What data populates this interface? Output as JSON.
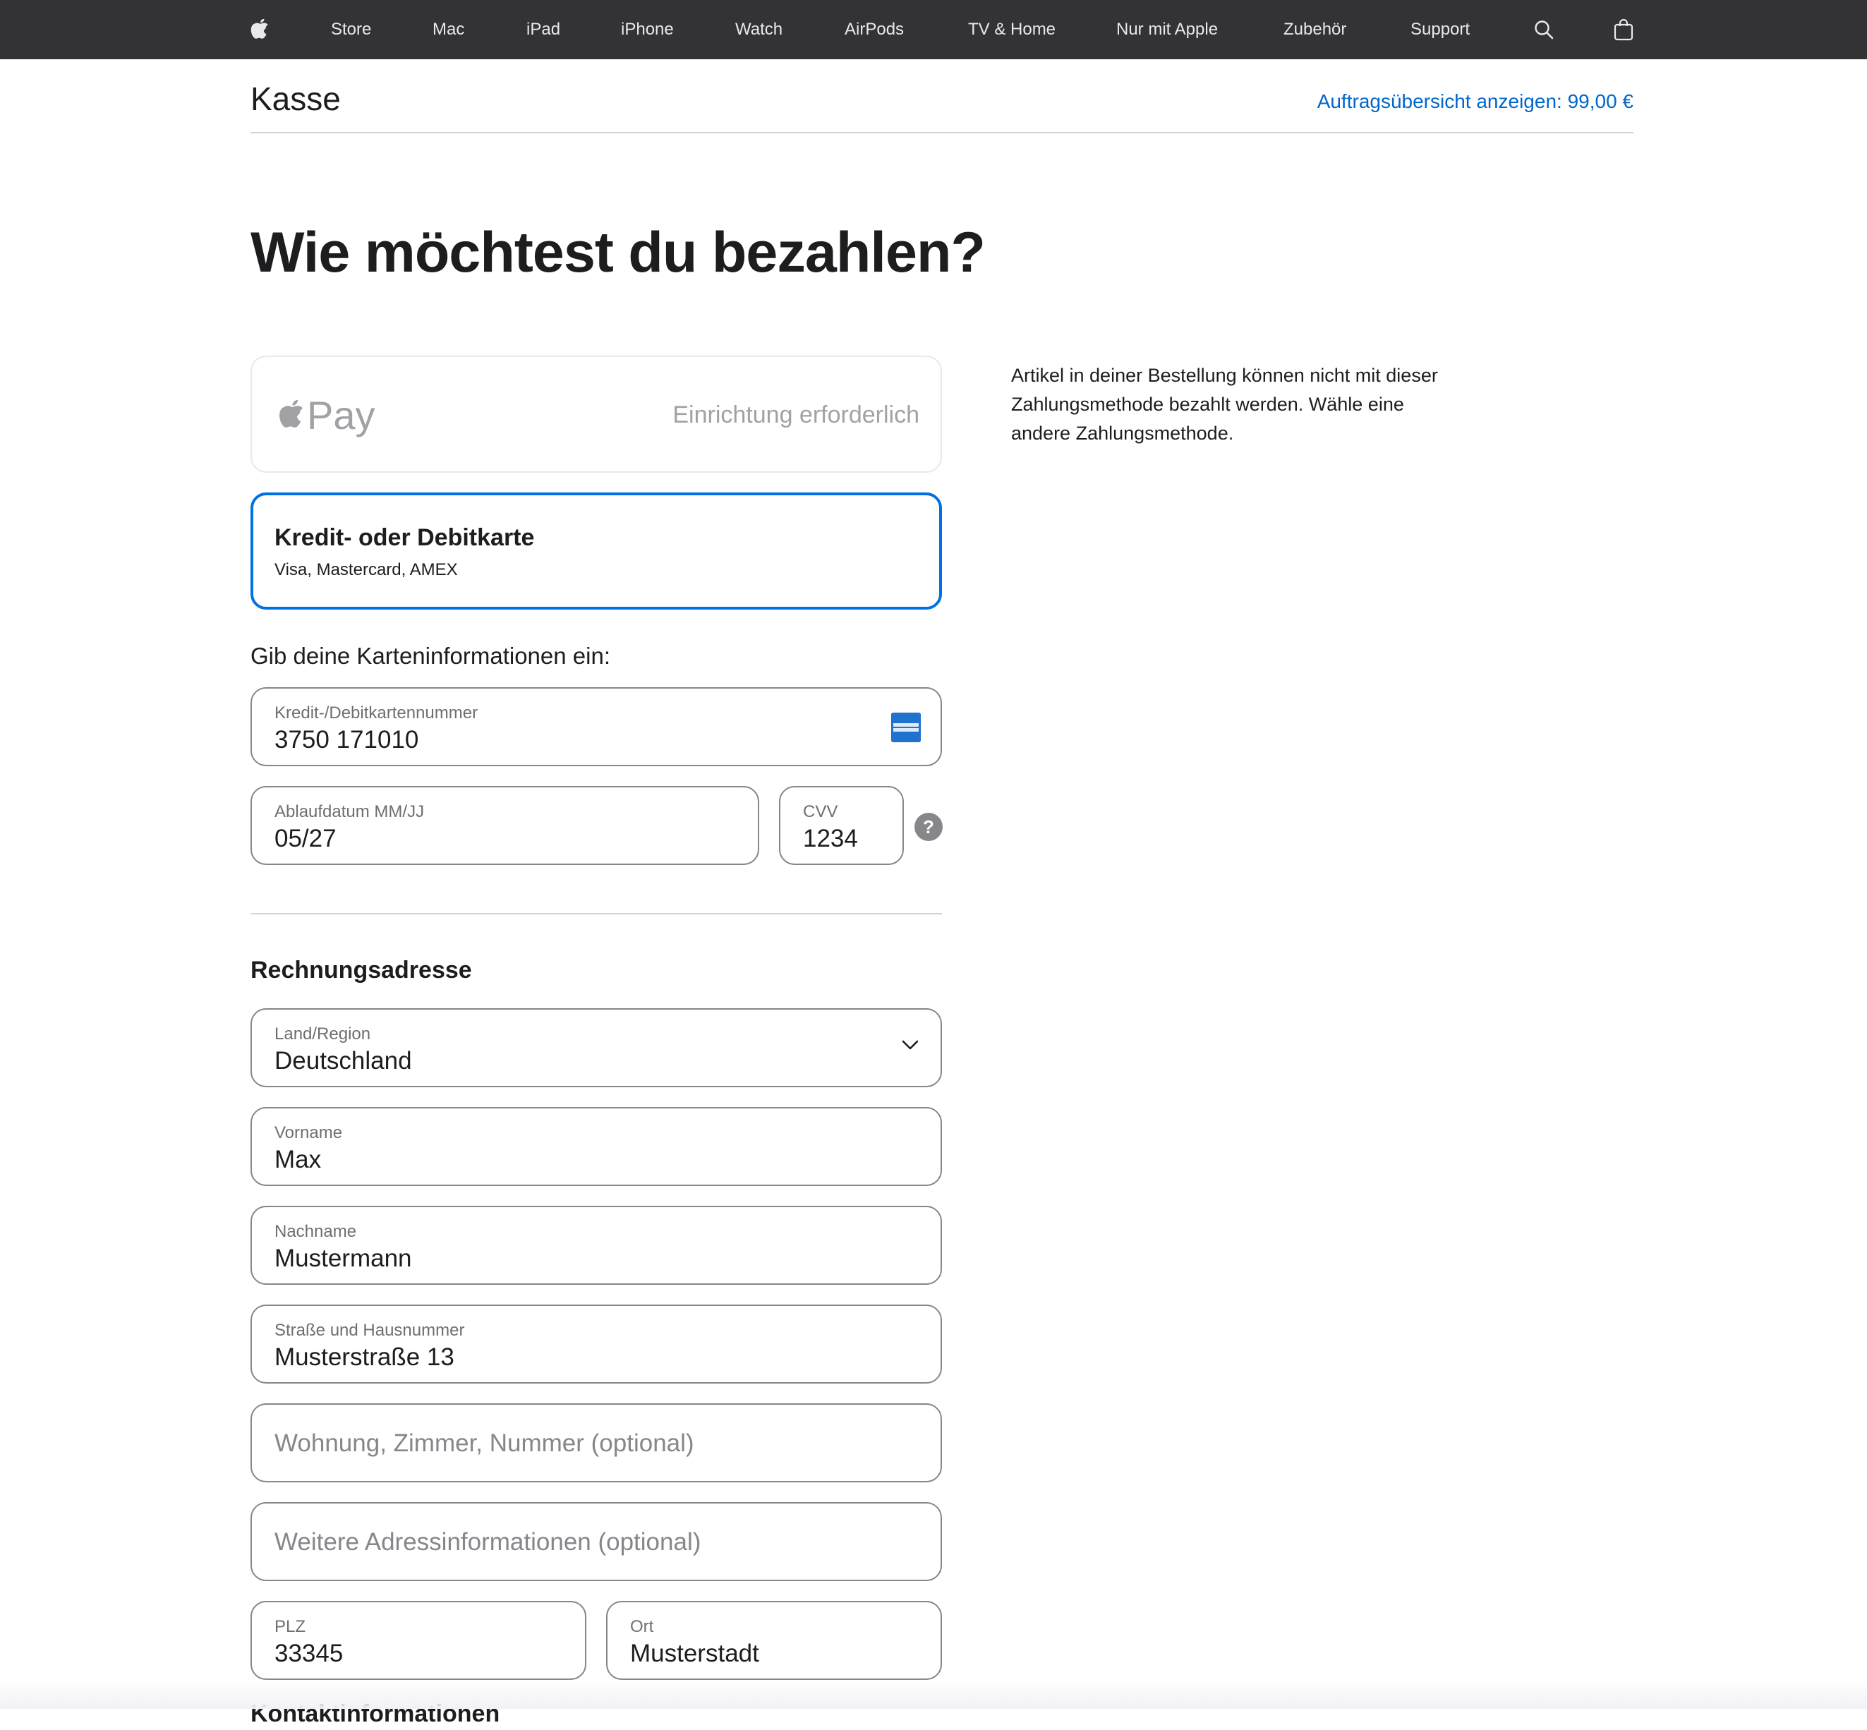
{
  "nav": {
    "items": [
      "Store",
      "Mac",
      "iPad",
      "iPhone",
      "Watch",
      "AirPods",
      "TV & Home",
      "Nur mit Apple",
      "Zubehör",
      "Support"
    ],
    "icons": {
      "logo": "apple-logo-icon",
      "search": "search-icon",
      "bag": "shopping-bag-icon"
    }
  },
  "header": {
    "title": "Kasse",
    "order_summary_link": "Auftragsübersicht anzeigen: 99,00 €"
  },
  "heading": "Wie möchtest du bezahlen?",
  "payment_options": {
    "apple_pay": {
      "logo_text": "Pay",
      "status": "Einrichtung erforderlich"
    },
    "card": {
      "title": "Kredit- oder Debitkarte",
      "subtitle": "Visa, Mastercard, AMEX"
    }
  },
  "side_note": "Artikel in deiner Bestellung können nicht mit dieser Zahlungsmethode bezahlt werden. Wähle eine andere Zahlungsmethode.",
  "card_form": {
    "prompt": "Gib deine Karteninformationen ein:",
    "number": {
      "label": "Kredit-/Debitkartennummer",
      "value": "3750 171010"
    },
    "expiry": {
      "label": "Ablaufdatum MM/JJ",
      "value": "05/27"
    },
    "cvv": {
      "label": "CVV",
      "value": "1234",
      "help": "?"
    }
  },
  "billing": {
    "heading": "Rechnungsadresse",
    "country": {
      "label": "Land/Region",
      "value": "Deutschland"
    },
    "first_name": {
      "label": "Vorname",
      "value": "Max"
    },
    "last_name": {
      "label": "Nachname",
      "value": "Mustermann"
    },
    "street": {
      "label": "Straße und Hausnummer",
      "value": "Musterstraße 13"
    },
    "apartment": {
      "placeholder": "Wohnung, Zimmer, Nummer (optional)"
    },
    "extra": {
      "placeholder": "Weitere Adressinformationen (optional)"
    },
    "zip": {
      "label": "PLZ",
      "value": "33345"
    },
    "city": {
      "label": "Ort",
      "value": "Musterstadt"
    }
  },
  "next_section_peek": "Kontaktinformationen",
  "colors": {
    "nav_bg": "#333336",
    "link": "#0071e3",
    "text": "#1d1d1f",
    "border": "#86868b",
    "muted": "#6e6e73"
  }
}
